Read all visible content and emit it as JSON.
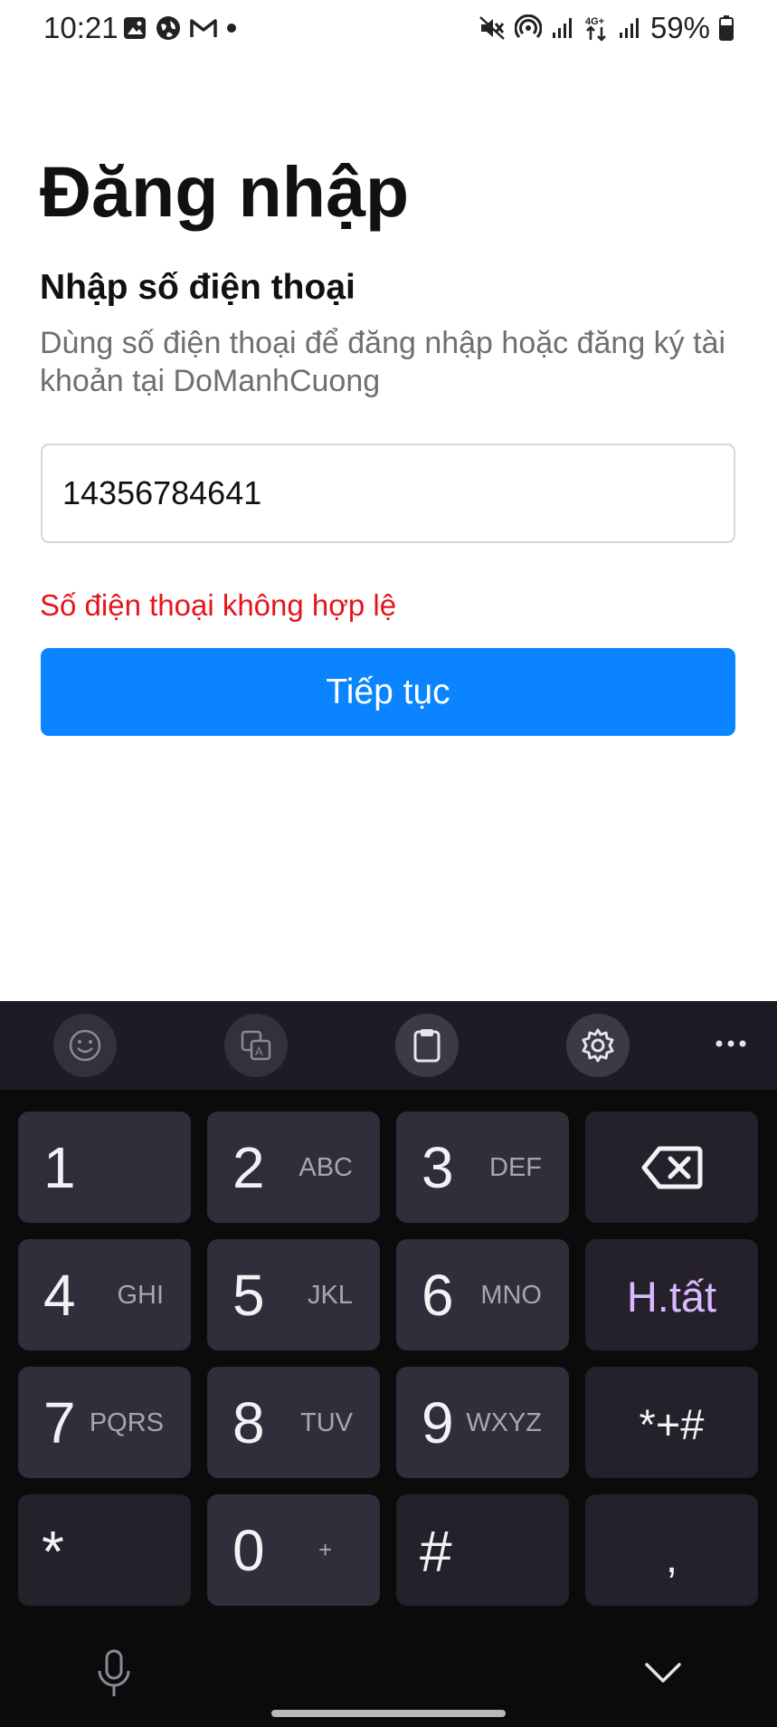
{
  "status_bar": {
    "time": "10:21",
    "battery_text": "59%",
    "left_icons": [
      "gallery-icon",
      "globe-icon",
      "gmail-icon",
      "dot-icon"
    ],
    "right_icons": [
      "mute-icon",
      "hotspot-icon",
      "signal-icon",
      "4g-icon",
      "signal-icon",
      "battery-icon"
    ]
  },
  "page": {
    "title": "Đăng nhập",
    "section_title": "Nhập số điện thoại",
    "description": "Dùng số điện thoại để đăng nhập hoặc đăng ký tài khoản tại DoManhCuong",
    "phone_value": "14356784641",
    "error": "Số điện thoại không hợp lệ",
    "continue_label": "Tiếp tục"
  },
  "keyboard": {
    "toolbar": [
      "emoji-icon",
      "translate-icon",
      "clipboard-icon",
      "settings-icon",
      "more-icon"
    ],
    "keys": {
      "k1": {
        "digit": "1",
        "letters": ""
      },
      "k2": {
        "digit": "2",
        "letters": "ABC"
      },
      "k3": {
        "digit": "3",
        "letters": "DEF"
      },
      "k4": {
        "digit": "4",
        "letters": "GHI"
      },
      "k5": {
        "digit": "5",
        "letters": "JKL"
      },
      "k6": {
        "digit": "6",
        "letters": "MNO"
      },
      "k7": {
        "digit": "7",
        "letters": "PQRS"
      },
      "k8": {
        "digit": "8",
        "letters": "TUV"
      },
      "k9": {
        "digit": "9",
        "letters": "WXYZ"
      },
      "k0": {
        "digit": "0",
        "letters": "+"
      },
      "star": "*",
      "hash": "#",
      "comma": ",",
      "done": "H.tất",
      "symbols": "*+#"
    }
  },
  "colors": {
    "accent": "#0a84ff",
    "error": "#e5151b",
    "keyboard_bg": "#0b0b0c",
    "key_bg": "#322d3a",
    "done_text": "#d9b8ff"
  }
}
